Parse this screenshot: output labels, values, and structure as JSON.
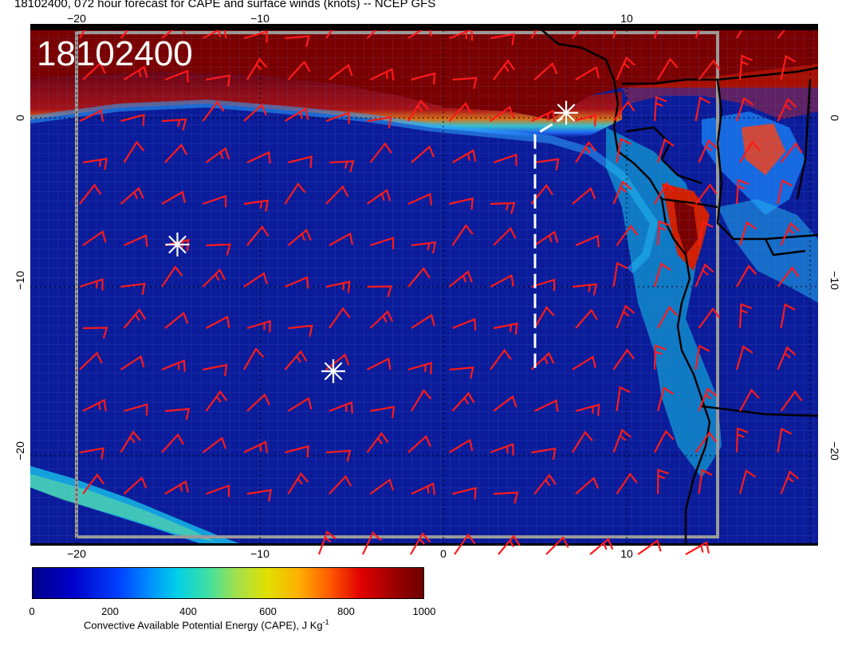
{
  "title": "18102400, 072 hour forecast for CAPE and surface winds (knots) -- NCEP GFS",
  "date_stamp": "18102400",
  "colors": {
    "bg_ocean": "#0a1c9a",
    "cape_high": "#7a0000",
    "wind_barb": "#ff1a1a",
    "coast": "#000000",
    "track": "#ffffff"
  },
  "axes": {
    "longitude": {
      "min": -22.5,
      "max": 20.5,
      "ticks": [
        "−20",
        "−10",
        "0",
        "10"
      ]
    },
    "latitude": {
      "min": -24,
      "max": 5,
      "ticks": [
        "0",
        "−10",
        "−20"
      ]
    }
  },
  "colorbar": {
    "ticks": [
      "0",
      "200",
      "400",
      "600",
      "800",
      "1000"
    ],
    "label": "Convective Available Potential Energy (CAPE), J Kg",
    "label_sup": "-1"
  },
  "markers": [
    {
      "type": "asterisk",
      "lon": -14.5,
      "lat": -7.5
    },
    {
      "type": "asterisk",
      "lon": -6,
      "lat": -15
    },
    {
      "type": "asterisk",
      "lon": 6.7,
      "lat": 0.3
    }
  ],
  "track_line": {
    "from": {
      "lon": 5,
      "lat": -14.8
    },
    "to": {
      "lon": 6.5,
      "lat": 0
    }
  }
}
